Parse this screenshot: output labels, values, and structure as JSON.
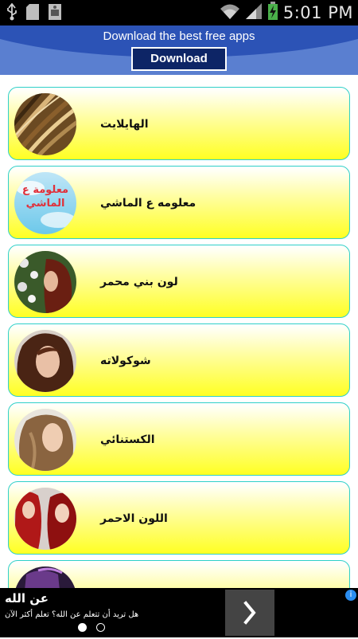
{
  "status_bar": {
    "time": "5:01 PM",
    "icons": [
      "usb-icon",
      "sd-card-icon",
      "image-icon",
      "wifi-icon",
      "signal-icon",
      "battery-charging-icon"
    ]
  },
  "banner": {
    "title": "Download the best free apps",
    "button_label": "Download"
  },
  "list": {
    "items": [
      {
        "label": "الهايلايت",
        "thumb": "highlight-hair"
      },
      {
        "label": "معلومه ع الماشي",
        "thumb": "info-graphic",
        "thumb_text": "معلومة ع الماشي"
      },
      {
        "label": "لون بني محمر",
        "thumb": "reddish-brown-hair"
      },
      {
        "label": "شوكولاته",
        "thumb": "chocolate-hair"
      },
      {
        "label": "الكستنائي",
        "thumb": "chestnut-hair"
      },
      {
        "label": "اللون الاحمر",
        "thumb": "red-hair"
      },
      {
        "label": "",
        "thumb": "dark-hair"
      }
    ]
  },
  "ad": {
    "title": "عن الله",
    "subtitle": "هل تريد أن تتعلم عن الله؟ تعلم أكثر الآن",
    "info_label": "i"
  }
}
